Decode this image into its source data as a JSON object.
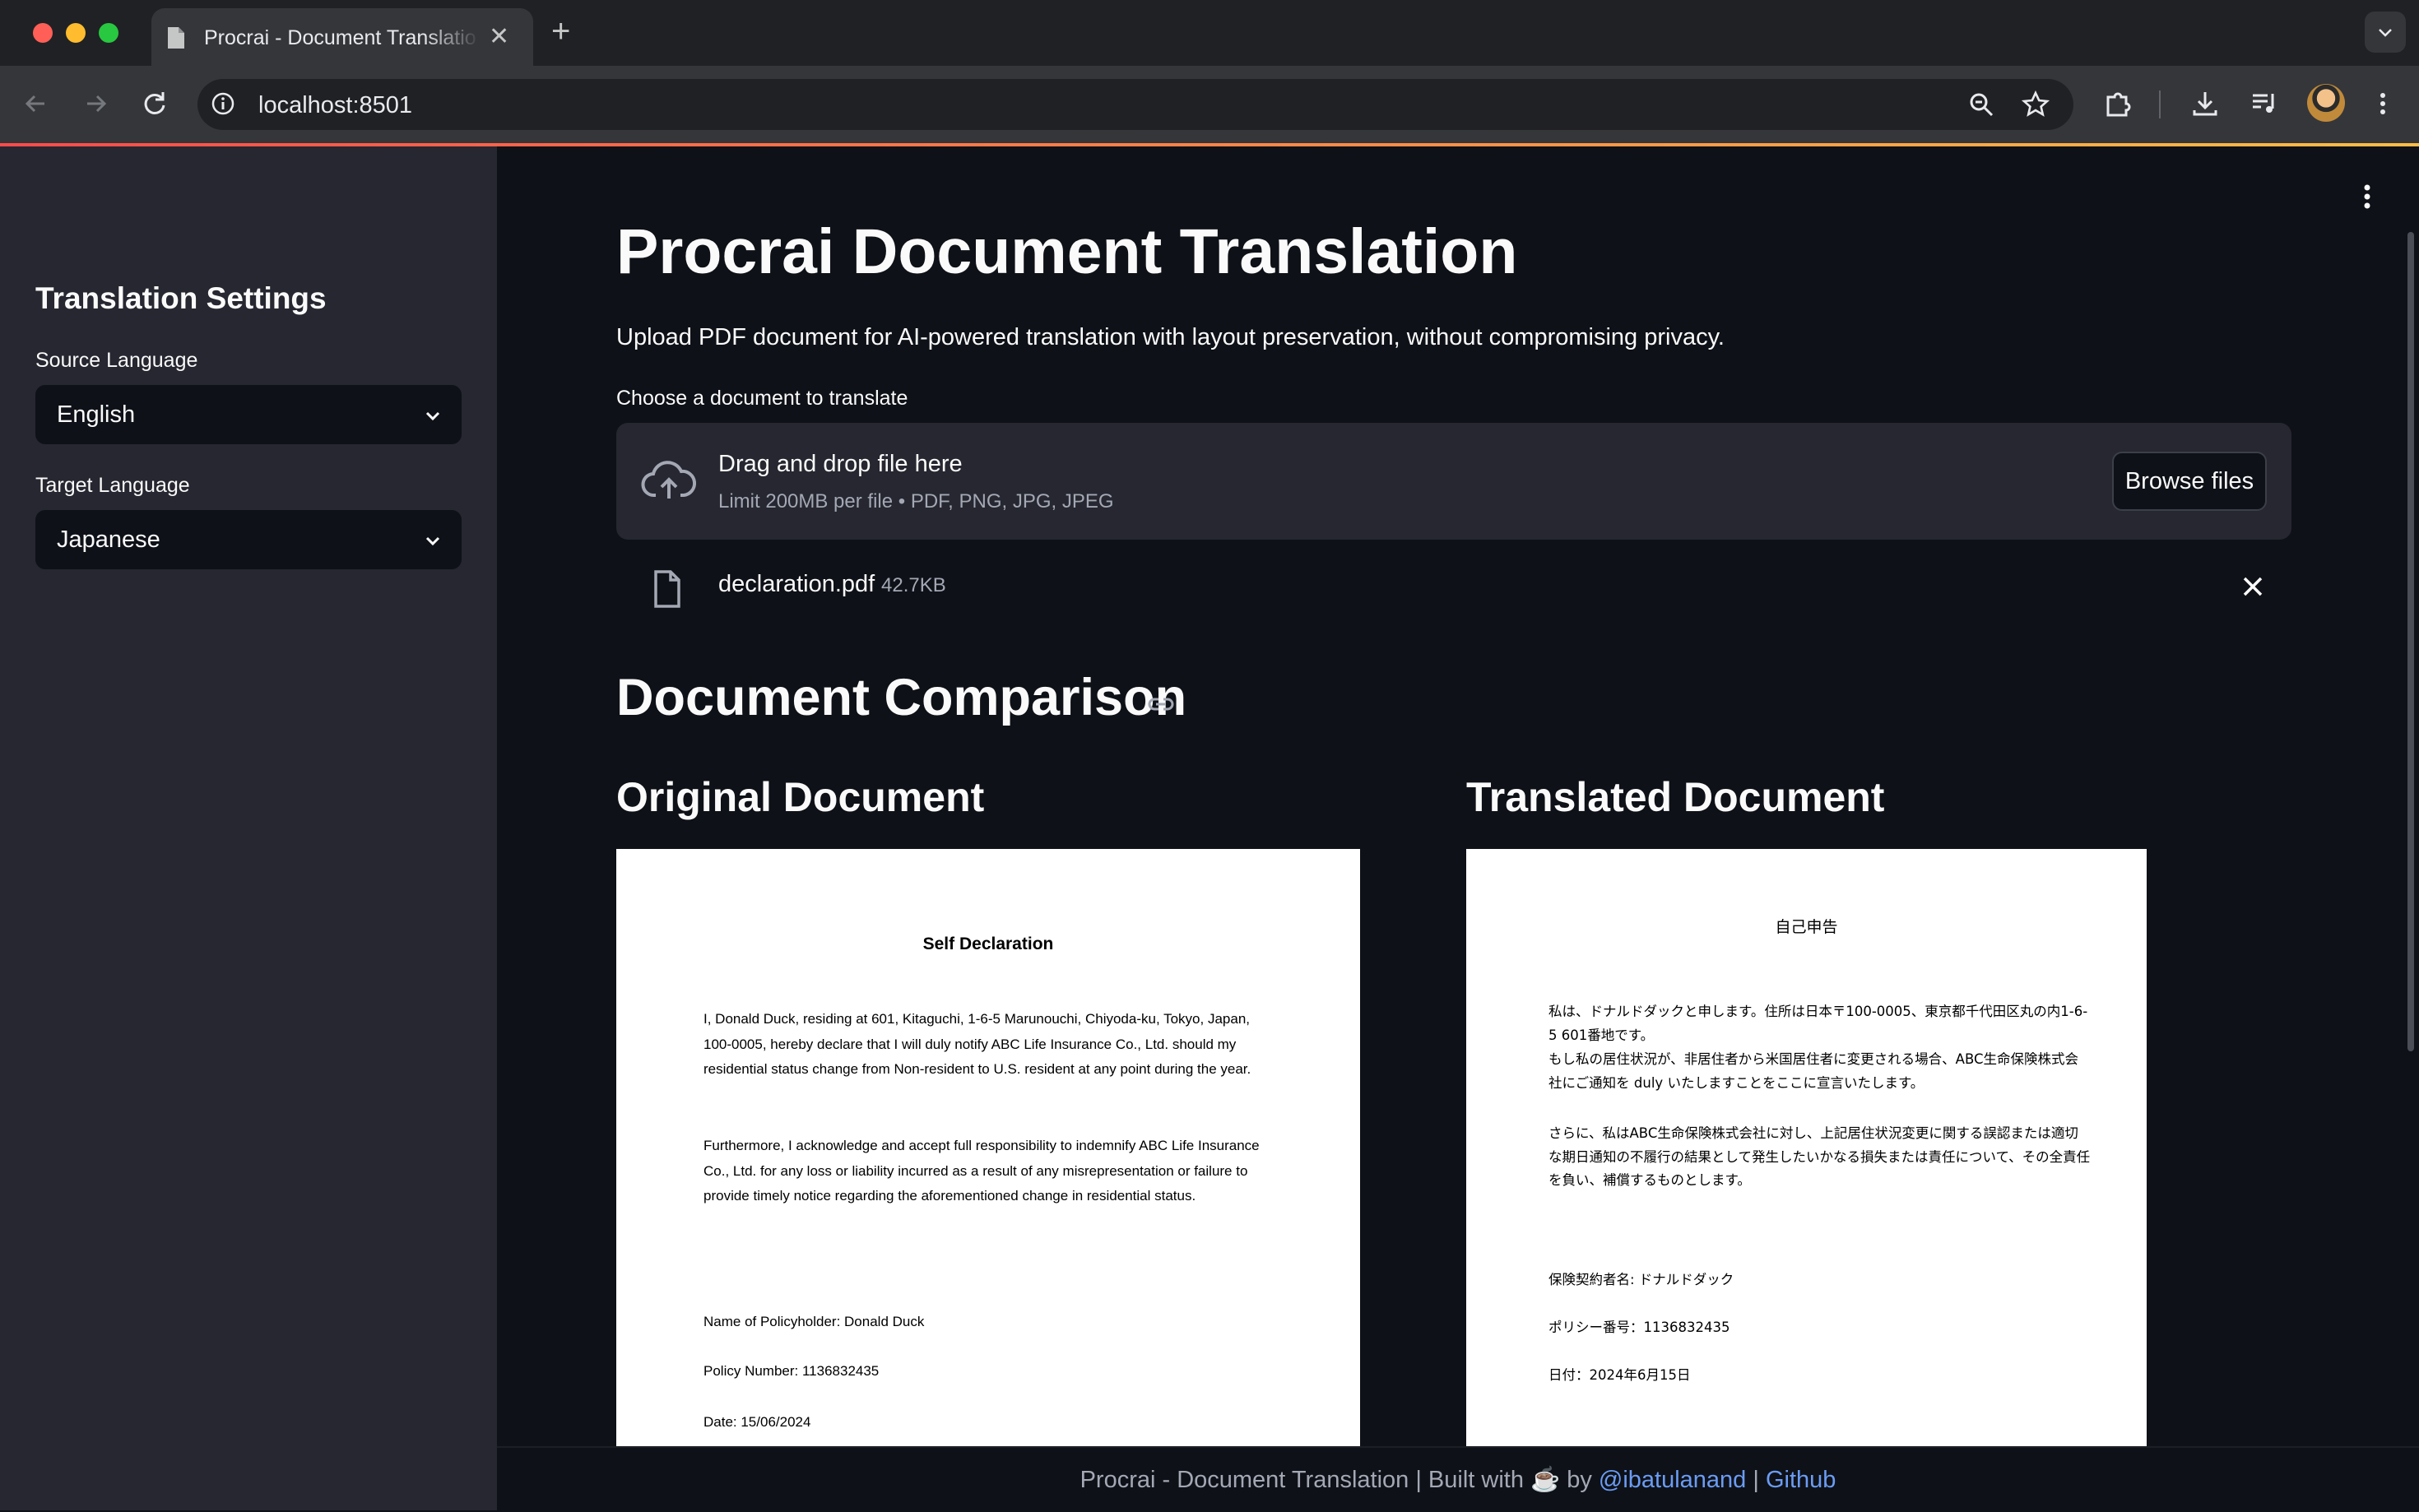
{
  "browser": {
    "tab_title": "Procrai - Document Translatio",
    "url": "localhost:8501"
  },
  "sidebar": {
    "heading": "Translation Settings",
    "source_label": "Source Language",
    "source_value": "English",
    "target_label": "Target Language",
    "target_value": "Japanese"
  },
  "main": {
    "title": "Procrai Document Translation",
    "subtitle": "Upload PDF document for AI-powered translation with layout preservation, without compromising privacy.",
    "uploader": {
      "label": "Choose a document to translate",
      "drop_title": "Drag and drop file here",
      "limit_text": "Limit 200MB per file • PDF, PNG, JPG, JPEG",
      "browse_label": "Browse files",
      "file_name": "declaration.pdf",
      "file_size": "42.7KB"
    },
    "comparison_title": "Document Comparison",
    "original_title": "Original Document",
    "translated_title": "Translated Document"
  },
  "original_doc": {
    "title": "Self Declaration",
    "para1": "I, Donald Duck, residing at 601, Kitaguchi, 1-6-5 Marunouchi, Chiyoda-ku, Tokyo, Japan, 100-0005, hereby declare that I will duly notify ABC Life Insurance Co., Ltd. should my residential status change from Non-resident to U.S. resident at any point during the year.",
    "para2": "Furthermore, I acknowledge and accept full responsibility to indemnify ABC Life Insurance Co., Ltd. for any loss or liability incurred as a result of any misrepresentation or failure to provide timely notice regarding the aforementioned change in residential status.",
    "name_line": "Name of Policyholder: Donald Duck",
    "policy_line": "Policy Number: 1136832435",
    "date_line": "Date: 15/06/2024"
  },
  "translated_doc": {
    "title": "自己申告",
    "para1": "私は、ドナルドダックと申します。住所は日本〒100-0005、東京都千代田区丸の内1-6-5 601番地です。",
    "para1b": "もし私の居住状況が、非居住者から米国居住者に変更される場合、ABC生命保険株式会社にご通知を duly いたしますことをここに宣言いたします。",
    "para2": "さらに、私はABC生命保険株式会社に対し、上記居住状況変更に関する誤認または適切な期日通知の不履行の結果として発生したいかなる損失または責任について、その全責任を負い、補償するものとします。",
    "name_line": "保険契約者名: ドナルドダック",
    "policy_line": "ポリシー番号：1136832435",
    "date_line": "日付：2024年6月15日"
  },
  "footer": {
    "prefix": "Procrai - Document Translation | Built with ☕ by",
    "author_link": "@ibatulanand",
    "separator": "|",
    "github_link": "Github"
  }
}
